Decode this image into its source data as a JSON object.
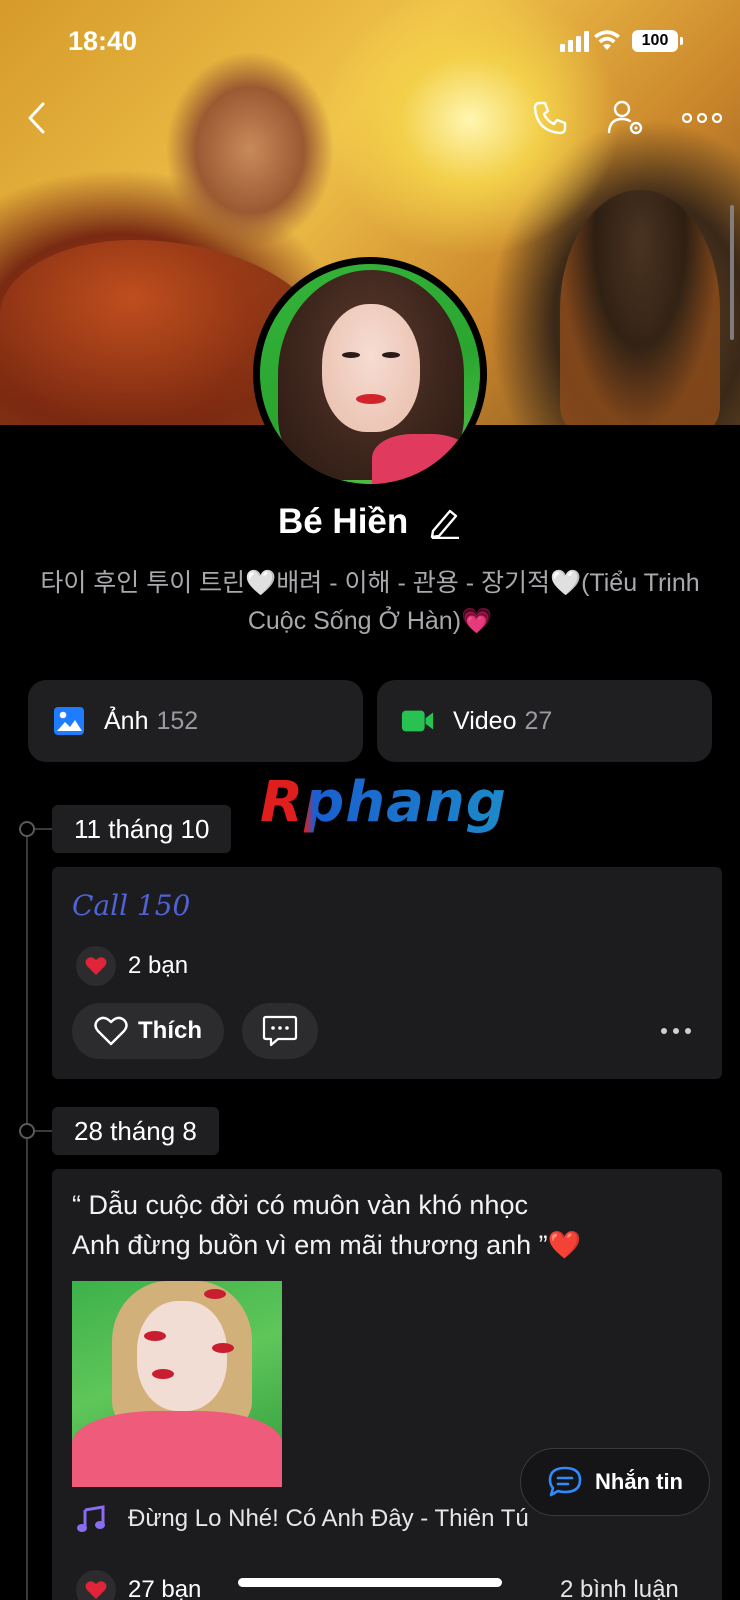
{
  "status_bar": {
    "time": "18:40",
    "battery": "100"
  },
  "profile": {
    "name": "Bé Hiền",
    "bio": "타이 후인 투이 트린🤍배려 - 이해 - 관용 - 장기적🤍(Tiểu Trinh Cuộc Sống Ở Hàn)💗"
  },
  "albums": [
    {
      "label": "Ảnh",
      "count": "152",
      "icon": "image-icon",
      "color": "#1f7bff"
    },
    {
      "label": "Video",
      "count": "27",
      "icon": "video-camera-icon",
      "color": "#27c252"
    }
  ],
  "watermark": "Rphang",
  "posts": [
    {
      "date": "11 tháng 10",
      "content": "Call 150",
      "reactions": "2 bạn",
      "like_label": "Thích"
    },
    {
      "date": "28 tháng 8",
      "text_line1": "“ Dẫu cuộc đời có muôn vàn khó nhọc",
      "text_line2": "Anh đừng buồn vì em mãi thương anh ”❤️",
      "music": "Đừng Lo Nhé! Có Anh Đây - Thiên Tú",
      "reactions": "27 bạn",
      "comments": "2 bình luận"
    }
  ],
  "message_button": {
    "label": "Nhắn tin"
  },
  "colors": {
    "accent_blue": "#1f7bff",
    "accent_green": "#27c252",
    "heart": "#e0253a",
    "script_text": "#4f63d6"
  }
}
